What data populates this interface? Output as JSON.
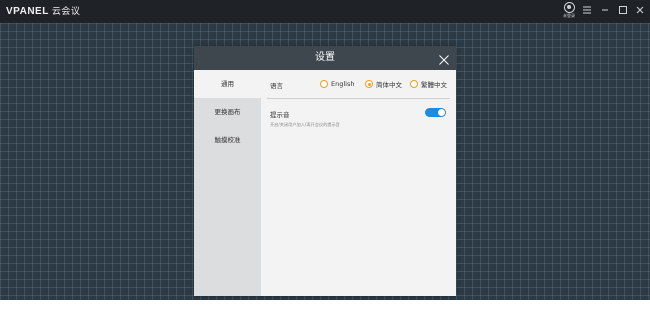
{
  "app": {
    "brand": "VPANEL",
    "name": "云会议",
    "user_label": "未登录"
  },
  "dialog": {
    "title": "设置"
  },
  "sidebar": {
    "items": [
      {
        "label": "通用",
        "active": true
      },
      {
        "label": "更换画布",
        "active": false
      },
      {
        "label": "触摸校准",
        "active": false
      }
    ]
  },
  "settings": {
    "language": {
      "label": "语言",
      "options": [
        {
          "label": "English",
          "selected": false
        },
        {
          "label": "简体中文",
          "selected": true
        },
        {
          "label": "繁體中文",
          "selected": false
        }
      ]
    },
    "tone": {
      "label": "提示音",
      "description": "开启/关闭用户加入/离开会议的提示音",
      "enabled": true
    }
  },
  "colors": {
    "accent": "#1f8be0",
    "radio": "#f0a020",
    "titlebar": "#1f2328",
    "dialog_header": "#3f474e",
    "workspace": "#2c3a45"
  }
}
